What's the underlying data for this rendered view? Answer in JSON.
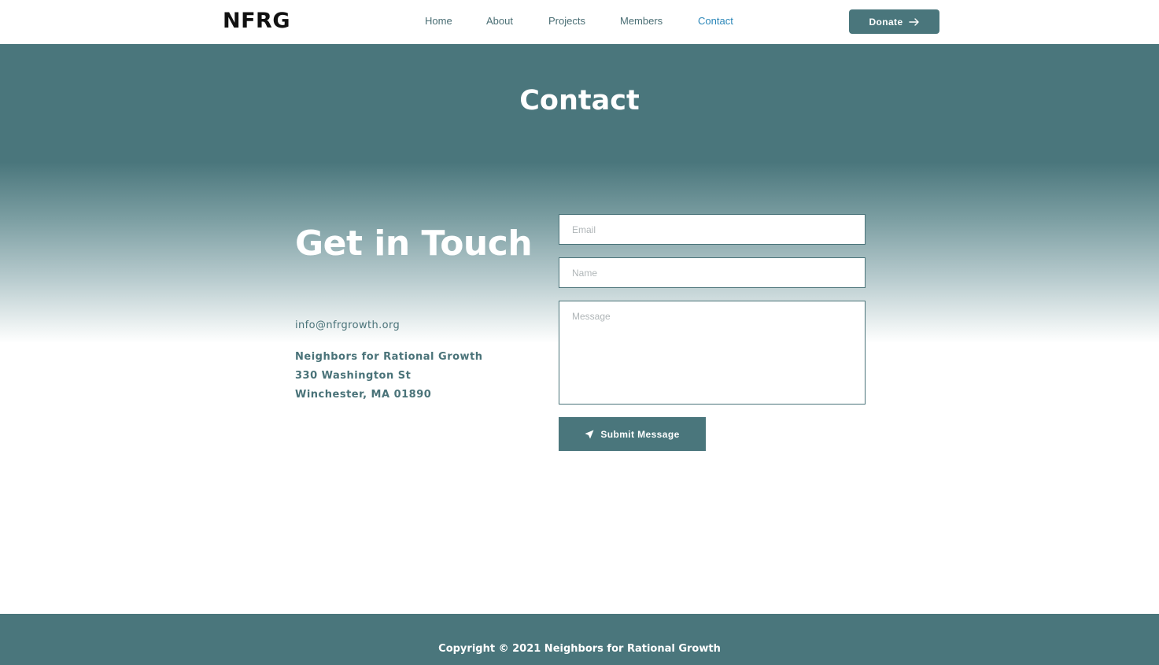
{
  "header": {
    "logo": "NFRG",
    "nav": [
      {
        "label": "Home",
        "active": false
      },
      {
        "label": "About",
        "active": false
      },
      {
        "label": "Projects",
        "active": false
      },
      {
        "label": "Members",
        "active": false
      },
      {
        "label": "Contact",
        "active": true
      }
    ],
    "donate_label": "Donate",
    "donate_icon": "arrow-right-icon"
  },
  "hero": {
    "title": "Contact"
  },
  "contact": {
    "heading": "Get in Touch",
    "email": "info@nfrgrowth.org",
    "address": [
      "Neighbors for Rational Growth",
      "330 Washington St",
      "Winchester, MA 01890"
    ]
  },
  "form": {
    "email_placeholder": "Email",
    "name_placeholder": "Name",
    "message_placeholder": "Message",
    "submit_label": "Submit Message",
    "submit_icon": "paper-plane-icon"
  },
  "footer": {
    "copyright": "Copyright © 2021 Neighbors for Rational Growth"
  },
  "colors": {
    "accent": "#4a767c",
    "active_link": "#2a86b8",
    "white": "#ffffff"
  }
}
